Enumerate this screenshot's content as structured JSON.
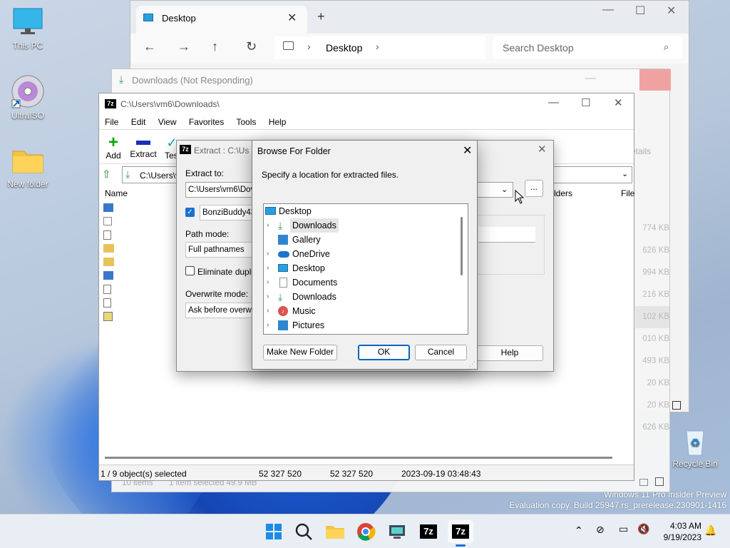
{
  "desktop": {
    "icons": [
      {
        "label": "This PC"
      },
      {
        "label": "UltraISO"
      },
      {
        "label": "New folder"
      },
      {
        "label": "Recycle Bin"
      }
    ],
    "watermark_line1": "Windows 11 Pro Insider Preview",
    "watermark_line2": "Evaluation copy. Build 25947.rs_prerelease.230901-1416"
  },
  "explorer": {
    "tab_title": "Desktop",
    "breadcrumb": "Desktop",
    "search_placeholder": "Search Desktop"
  },
  "downloads_window": {
    "title": "Downloads (Not Responding)",
    "status_items": "10 items",
    "status_selected": "1 item selected  49.9 MB",
    "right_labels": [
      "ls",
      "etails"
    ],
    "sizes": [
      "774 KB",
      "626 KB",
      "994 KB",
      "216 KB",
      "102 KB",
      "010 KB",
      "493 KB",
      "20 KB",
      "20 KB",
      "626 KB"
    ]
  },
  "zip": {
    "title": "C:\\Users\\vm6\\Downloads\\",
    "menu": [
      "File",
      "Edit",
      "View",
      "Favorites",
      "Tools",
      "Help"
    ],
    "toolbar": {
      "add": "Add",
      "extract": "Extract",
      "test": "Test"
    },
    "path": "C:\\Users\\vm6\\Downloads\\",
    "col_name": "Name",
    "col_folders": "lders",
    "col_file": "File",
    "status": {
      "selected": "1 / 9 object(s) selected",
      "size": "52 327 520",
      "packed": "52 327 520",
      "modified": "2023-09-19 03:48:43"
    }
  },
  "extract": {
    "title": "Extract : C:\\Us",
    "extract_to_label": "Extract to:",
    "extract_to_value": "C:\\Users\\vm6\\Dov",
    "subfolder_value": "BonziBuddy43",
    "path_mode_label": "Path mode:",
    "path_mode_value": "Full pathnames",
    "eliminate_label": "Eliminate duplica",
    "overwrite_label": "Overwrite mode:",
    "overwrite_value": "Ask before overwrit",
    "browse_btn": "...",
    "help_btn": "Help"
  },
  "browse": {
    "title": "Browse For Folder",
    "instruction": "Specify a location for extracted files.",
    "tree": [
      {
        "label": "Desktop",
        "icon": "desktop-icon",
        "color": "#2a8bd8"
      },
      {
        "label": "Downloads",
        "icon": "download-icon",
        "color": "#2b9b59"
      },
      {
        "label": "Gallery",
        "icon": "gallery-icon",
        "color": "#2f86d0"
      },
      {
        "label": "OneDrive",
        "icon": "cloud-icon",
        "color": "#1a73d1"
      },
      {
        "label": "Desktop",
        "icon": "desktop-icon",
        "color": "#2a8bd8"
      },
      {
        "label": "Documents",
        "icon": "document-icon",
        "color": "#8a95a3"
      },
      {
        "label": "Downloads",
        "icon": "download-icon",
        "color": "#2b9b59"
      },
      {
        "label": "Music",
        "icon": "music-icon",
        "color": "#d9534f"
      },
      {
        "label": "Pictures",
        "icon": "pictures-icon",
        "color": "#2f86d0"
      }
    ],
    "new_folder_btn": "Make New Folder",
    "ok_btn": "OK",
    "cancel_btn": "Cancel"
  },
  "taskbar": {
    "time": "4:03 AM",
    "date": "9/19/2023"
  }
}
